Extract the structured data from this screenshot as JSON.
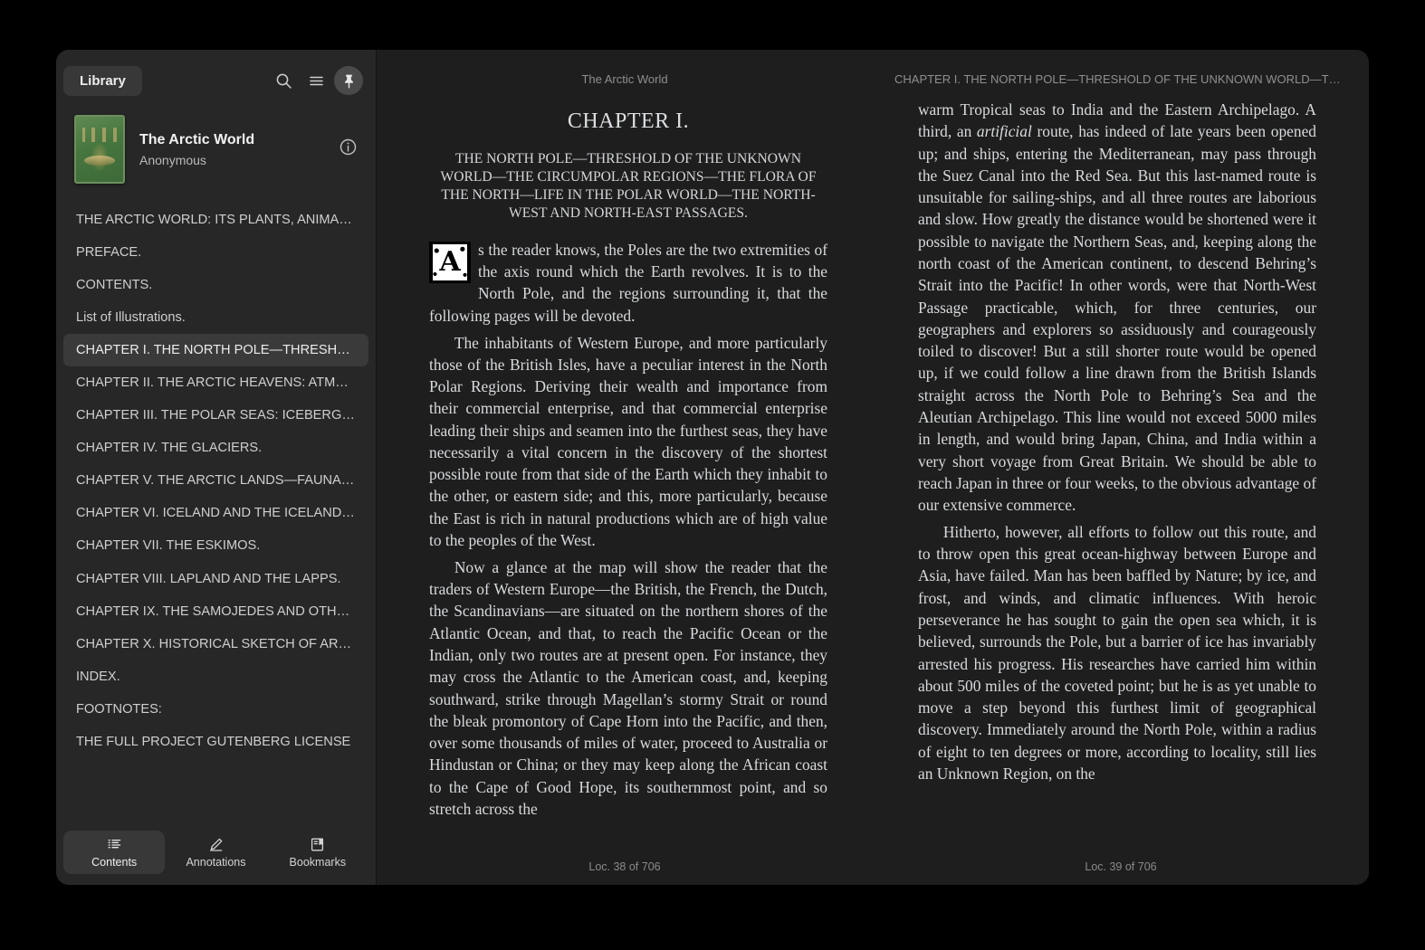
{
  "sidebar": {
    "library_button": "Library",
    "icons": {
      "search": "search-icon",
      "menu": "hamburger-menu-icon",
      "pin": "pin-icon",
      "info": "info-icon"
    },
    "book": {
      "title": "The Arctic World",
      "author": "Anonymous",
      "cover_color": "#46763f"
    },
    "toc": [
      {
        "label": "THE ARCTIC WORLD: ITS PLANTS, ANIMALS, …",
        "selected": false
      },
      {
        "label": "PREFACE.",
        "selected": false
      },
      {
        "label": "CONTENTS.",
        "selected": false
      },
      {
        "label": "List of Illustrations.",
        "selected": false
      },
      {
        "label": "CHAPTER I. THE NORTH POLE—THRESHOLD …",
        "selected": true
      },
      {
        "label": "CHAPTER II. THE ARCTIC HEAVENS: ATMOSP…",
        "selected": false
      },
      {
        "label": "CHAPTER III. THE POLAR SEAS: ICEBERGS—I…",
        "selected": false
      },
      {
        "label": "CHAPTER IV. THE GLACIERS.",
        "selected": false
      },
      {
        "label": "CHAPTER V. THE ARCTIC LANDS—FAUNA—F…",
        "selected": false
      },
      {
        "label": "CHAPTER VI. ICELAND AND THE ICELANDERS.",
        "selected": false
      },
      {
        "label": "CHAPTER VII. THE ESKIMOS.",
        "selected": false
      },
      {
        "label": "CHAPTER VIII. LAPLAND AND THE LAPPS.",
        "selected": false
      },
      {
        "label": "CHAPTER IX. THE SAMOJEDES AND OTHER T…",
        "selected": false
      },
      {
        "label": "CHAPTER X. HISTORICAL SKETCH OF ARCTIC …",
        "selected": false
      },
      {
        "label": "INDEX.",
        "selected": false
      },
      {
        "label": "FOOTNOTES:",
        "selected": false
      },
      {
        "label": "THE FULL PROJECT GUTENBERG LICENSE",
        "selected": false
      }
    ],
    "tabs": [
      {
        "label": "Contents",
        "icon": "list-icon",
        "selected": true
      },
      {
        "label": "Annotations",
        "icon": "pencil-icon",
        "selected": false
      },
      {
        "label": "Bookmarks",
        "icon": "bookmark-icon",
        "selected": false
      }
    ]
  },
  "reader": {
    "running_head_left": "The Arctic World",
    "running_head_right": "CHAPTER I. THE NORTH POLE—THRESHOLD OF THE UNKNOWN WORLD—TH…",
    "chapter_number": "CHAPTER I.",
    "chapter_subtitle": "THE NORTH POLE—THRESHOLD OF THE UNKNOWN WORLD—THE CIRCUMPOLAR REGIONS—THE FLORA OF THE NORTH—LIFE IN THE POLAR WORLD—THE NORTH-WEST AND NORTH-EAST PASSAGES.",
    "dropcap": "A",
    "left_page": {
      "para1_rest": "s the reader knows, the Poles are the two extremities of the axis round which the Earth revolves. It is to the North Pole, and the regions surrounding it, that the following pages will be devoted.",
      "para2": "The inhabitants of Western Europe, and more particularly those of the British Isles, have a peculiar interest in the North Polar Regions. Deriving their wealth and importance from their commercial enterprise, and that commercial enterprise leading their ships and seamen into the furthest seas, they have necessarily a vital concern in the discovery of the shortest possible route from that side of the Earth which they inhabit to the other, or eastern side; and this, more particularly, because the East is rich in natural productions which are of high value to the peoples of the West.",
      "para3": "Now a glance at the map will show the reader that the traders of Western Europe—the British, the French, the Dutch, the Scandinavians—are situated on the northern shores of the Atlantic Ocean, and that, to reach the Pacific Ocean or the Indian, only two routes are at present open. For instance, they may cross the Atlantic to the American coast, and, keeping southward, strike through Magellan’s stormy Strait or round the bleak promontory of Cape Horn into the Pacific, and then, over some thousands of miles of water, proceed to Australia or Hindustan or China; or they may keep along the African coast to the Cape of Good Hope, its southernmost point, and so stretch across the",
      "location": "Loc. 38 of 706"
    },
    "right_page": {
      "para1_a": "warm Tropical seas to India and the Eastern Archipelago. A third, an ",
      "para1_italic": "artificial",
      "para1_b": " route, has indeed of late years been opened up; and ships, entering the Mediterranean, may pass through the Suez Canal into the Red Sea. But this last-named route is unsuitable for sailing-ships, and all three routes are laborious and slow. How greatly the distance would be shortened were it possible to navigate the Northern Seas, and, keeping along the north coast of the American continent, to descend Behring’s Strait into the Pacific! In other words, were that North-West Passage practicable, which, for three centuries, our geographers and explorers so assiduously and courageously toiled to discover! But a still shorter route would be opened up, if we could follow a line drawn from the British Islands straight across the North Pole to Behring’s Sea and the Aleutian Archipelago. This line would not exceed 5000 miles in length, and would bring Japan, China, and India within a very short voyage from Great Britain. We should be able to reach Japan in three or four weeks, to the obvious advantage of our extensive commerce.",
      "para2": "Hitherto, however, all efforts to follow out this route, and to throw open this great ocean-highway between Europe and Asia, have failed. Man has been baffled by Nature; by ice, and frost, and winds, and climatic influences. With heroic perseverance he has sought to gain the open sea which, it is believed, surrounds the Pole, but a barrier of ice has invariably arrested his progress. His researches have carried him within about 500 miles of the coveted point; but he is as yet unable to move a step beyond this furthest limit of geographical discovery. Immediately around the North Pole, within a radius of eight to ten degrees or more, according to locality, still lies an Unknown Region, on the",
      "location": "Loc. 39 of 706"
    }
  }
}
